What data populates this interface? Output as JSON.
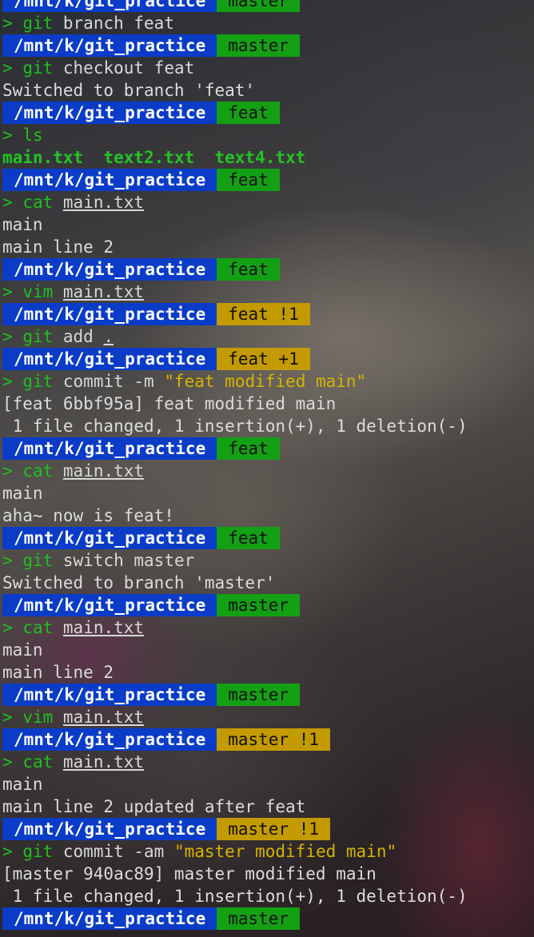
{
  "terminal": {
    "lines": [
      {
        "kind": "prompt",
        "path": "/mnt/k/git_practice",
        "branch": "master",
        "dirty": false
      },
      {
        "kind": "cmd",
        "cmd": "git",
        "rest": " branch feat"
      },
      {
        "kind": "prompt",
        "path": "/mnt/k/git_practice",
        "branch": "master",
        "dirty": false
      },
      {
        "kind": "cmd",
        "cmd": "git",
        "rest": " checkout feat"
      },
      {
        "kind": "out",
        "text": "Switched to branch 'feat'"
      },
      {
        "kind": "prompt",
        "path": "/mnt/k/git_practice",
        "branch": "feat",
        "dirty": false
      },
      {
        "kind": "cmd",
        "cmd": "ls",
        "rest": ""
      },
      {
        "kind": "files",
        "text": "main.txt  text2.txt  text4.txt"
      },
      {
        "kind": "prompt",
        "path": "/mnt/k/git_practice",
        "branch": "feat",
        "dirty": false
      },
      {
        "kind": "cmd",
        "cmd": "cat",
        "rest": " ",
        "ul": "main.txt"
      },
      {
        "kind": "out",
        "text": "main"
      },
      {
        "kind": "out",
        "text": "main line 2"
      },
      {
        "kind": "prompt",
        "path": "/mnt/k/git_practice",
        "branch": "feat",
        "dirty": false
      },
      {
        "kind": "cmd",
        "cmd": "vim",
        "rest": " ",
        "ul": "main.txt"
      },
      {
        "kind": "prompt",
        "path": "/mnt/k/git_practice",
        "branch": "feat !1",
        "dirty": true
      },
      {
        "kind": "cmd",
        "cmd": "git",
        "rest": " add ",
        "ul": "."
      },
      {
        "kind": "prompt",
        "path": "/mnt/k/git_practice",
        "branch": "feat +1",
        "dirty": true
      },
      {
        "kind": "cmd",
        "cmd": "git",
        "rest": " commit -m ",
        "str": "\"feat modified main\""
      },
      {
        "kind": "out",
        "text": "[feat 6bbf95a] feat modified main"
      },
      {
        "kind": "out",
        "text": " 1 file changed, 1 insertion(+), 1 deletion(-)"
      },
      {
        "kind": "prompt",
        "path": "/mnt/k/git_practice",
        "branch": "feat",
        "dirty": false
      },
      {
        "kind": "cmd",
        "cmd": "cat",
        "rest": " ",
        "ul": "main.txt"
      },
      {
        "kind": "out",
        "text": "main"
      },
      {
        "kind": "out",
        "text": "aha~ now is feat!"
      },
      {
        "kind": "prompt",
        "path": "/mnt/k/git_practice",
        "branch": "feat",
        "dirty": false
      },
      {
        "kind": "cmd",
        "cmd": "git",
        "rest": " switch master"
      },
      {
        "kind": "out",
        "text": "Switched to branch 'master'"
      },
      {
        "kind": "prompt",
        "path": "/mnt/k/git_practice",
        "branch": "master",
        "dirty": false
      },
      {
        "kind": "cmd",
        "cmd": "cat",
        "rest": " ",
        "ul": "main.txt"
      },
      {
        "kind": "out",
        "text": "main"
      },
      {
        "kind": "out",
        "text": "main line 2"
      },
      {
        "kind": "prompt",
        "path": "/mnt/k/git_practice",
        "branch": "master",
        "dirty": false
      },
      {
        "kind": "cmd",
        "cmd": "vim",
        "rest": " ",
        "ul": "main.txt"
      },
      {
        "kind": "prompt",
        "path": "/mnt/k/git_practice",
        "branch": "master !1",
        "dirty": true
      },
      {
        "kind": "cmd",
        "cmd": "cat",
        "rest": " ",
        "ul": "main.txt"
      },
      {
        "kind": "out",
        "text": "main"
      },
      {
        "kind": "out",
        "text": "main line 2 updated after feat"
      },
      {
        "kind": "prompt",
        "path": "/mnt/k/git_practice",
        "branch": "master !1",
        "dirty": true
      },
      {
        "kind": "cmd",
        "cmd": "git",
        "rest": " commit -am ",
        "str": "\"master modified main\""
      },
      {
        "kind": "out",
        "text": "[master 940ac89] master modified main"
      },
      {
        "kind": "out",
        "text": " 1 file changed, 1 insertion(+), 1 deletion(-)"
      },
      {
        "kind": "prompt",
        "path": "/mnt/k/git_practice",
        "branch": "master",
        "dirty": false
      }
    ],
    "prompt_char": ">",
    "colors": {
      "path_bg": "#0a3cc8",
      "branch_clean_bg": "#14a014",
      "branch_dirty_bg": "#c39a00",
      "command": "#1fbf1f",
      "string": "#d6b300"
    }
  }
}
